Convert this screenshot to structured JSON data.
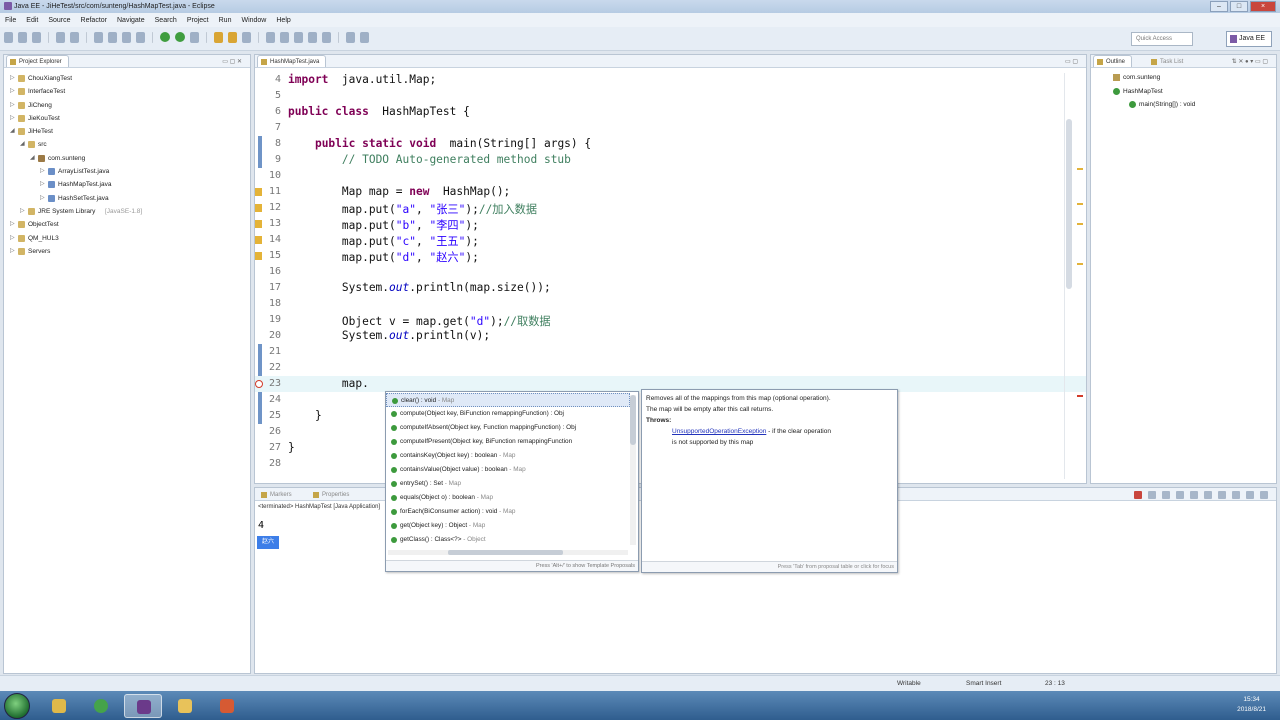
{
  "window": {
    "title": "Java EE - JiHeTest/src/com/sunteng/HashMapTest.java - Eclipse"
  },
  "menu": [
    "File",
    "Edit",
    "Source",
    "Refactor",
    "Navigate",
    "Search",
    "Project",
    "Run",
    "Window",
    "Help"
  ],
  "toolbar": {
    "quick_access": "Quick Access",
    "perspective": "Java EE"
  },
  "explorer": {
    "tab": "Project Explorer",
    "items": [
      {
        "label": "ChouXiangTest",
        "depth": 0,
        "twisty": "▷"
      },
      {
        "label": "InterfaceTest",
        "depth": 0,
        "twisty": "▷"
      },
      {
        "label": "JiCheng",
        "depth": 0,
        "twisty": "▷"
      },
      {
        "label": "JieKouTest",
        "depth": 0,
        "twisty": "▷"
      },
      {
        "label": "JiHeTest",
        "depth": 0,
        "twisty": "◢"
      },
      {
        "label": "src",
        "depth": 1,
        "twisty": "◢"
      },
      {
        "label": "com.sunteng",
        "depth": 2,
        "twisty": "◢"
      },
      {
        "label": "ArrayListTest.java",
        "depth": 3,
        "twisty": "▷"
      },
      {
        "label": "HashMapTest.java",
        "depth": 3,
        "twisty": "▷"
      },
      {
        "label": "HashSetTest.java",
        "depth": 3,
        "twisty": "▷"
      },
      {
        "label": "JRE System Library",
        "extra": "[JavaSE-1.8]",
        "depth": 1,
        "twisty": "▷"
      },
      {
        "label": "ObjectTest",
        "depth": 0,
        "twisty": "▷"
      },
      {
        "label": "QM_HUL3",
        "depth": 0,
        "twisty": "▷"
      },
      {
        "label": "Servers",
        "depth": 0,
        "twisty": "▷"
      }
    ]
  },
  "editor": {
    "tab": "HashMapTest.java",
    "lines": [
      {
        "n": "4",
        "segs": [
          [
            "kw",
            "import"
          ],
          [
            "",
            "  java.util.Map;"
          ]
        ]
      },
      {
        "n": "5",
        "segs": []
      },
      {
        "n": "6",
        "segs": [
          [
            "kw",
            "public class"
          ],
          [
            "",
            "  HashMapTest {"
          ]
        ]
      },
      {
        "n": "7",
        "segs": []
      },
      {
        "n": "8",
        "segs": [
          [
            "",
            "    "
          ],
          [
            "kw",
            "public static void"
          ],
          [
            "",
            "  main(String[] args) {"
          ]
        ],
        "marker": "info"
      },
      {
        "n": "9",
        "segs": [
          [
            "",
            "        "
          ],
          [
            "cm",
            "// TODO Auto-generated method stub"
          ]
        ],
        "marker": "info"
      },
      {
        "n": "10",
        "segs": []
      },
      {
        "n": "11",
        "segs": [
          [
            "",
            "        Map map = "
          ],
          [
            "kw",
            "new"
          ],
          [
            "",
            "  HashMap();"
          ]
        ],
        "marker": "warn"
      },
      {
        "n": "12",
        "segs": [
          [
            "",
            "        map.put("
          ],
          [
            "st",
            "\"a\""
          ],
          [
            "",
            ", "
          ],
          [
            "st",
            "\"张三\""
          ],
          [
            "",
            ");"
          ],
          [
            "cm",
            "//加入数据"
          ]
        ],
        "marker": "warn"
      },
      {
        "n": "13",
        "segs": [
          [
            "",
            "        map.put("
          ],
          [
            "st",
            "\"b\""
          ],
          [
            "",
            ", "
          ],
          [
            "st",
            "\"李四\""
          ],
          [
            "",
            ");"
          ]
        ],
        "marker": "warn"
      },
      {
        "n": "14",
        "segs": [
          [
            "",
            "        map.put("
          ],
          [
            "st",
            "\"c\""
          ],
          [
            "",
            ", "
          ],
          [
            "st",
            "\"王五\""
          ],
          [
            "",
            ");"
          ]
        ],
        "marker": "warn"
      },
      {
        "n": "15",
        "segs": [
          [
            "",
            "        map.put("
          ],
          [
            "st",
            "\"d\""
          ],
          [
            "",
            ", "
          ],
          [
            "st",
            "\"赵六\""
          ],
          [
            "",
            ");"
          ]
        ],
        "marker": "warn"
      },
      {
        "n": "16",
        "segs": []
      },
      {
        "n": "17",
        "segs": [
          [
            "",
            "        System."
          ],
          [
            "fd",
            "out"
          ],
          [
            "",
            ".println(map.size());"
          ]
        ]
      },
      {
        "n": "18",
        "segs": []
      },
      {
        "n": "19",
        "segs": [
          [
            "",
            "        Object v = map.get("
          ],
          [
            "st",
            "\"d\""
          ],
          [
            "",
            ");"
          ],
          [
            "cm",
            "//取数据"
          ]
        ]
      },
      {
        "n": "20",
        "segs": [
          [
            "",
            "        System."
          ],
          [
            "fd",
            "out"
          ],
          [
            "",
            ".println(v);"
          ]
        ]
      },
      {
        "n": "21",
        "segs": [],
        "marker": "info"
      },
      {
        "n": "22",
        "segs": [],
        "marker": "info"
      },
      {
        "n": "23",
        "segs": [
          [
            "",
            "        map."
          ]
        ],
        "marker": "err",
        "current": true
      },
      {
        "n": "24",
        "segs": [],
        "marker": "info"
      },
      {
        "n": "25",
        "segs": [
          [
            "",
            "    }"
          ]
        ],
        "marker": "info"
      },
      {
        "n": "26",
        "segs": []
      },
      {
        "n": "27",
        "segs": [
          [
            "",
            "}"
          ]
        ]
      },
      {
        "n": "28",
        "segs": []
      }
    ]
  },
  "outline": {
    "tabs": [
      "Outline",
      "Task List"
    ],
    "items": [
      {
        "label": "com.sunteng",
        "kind": "pkg",
        "depth": 0
      },
      {
        "label": "HashMapTest",
        "kind": "class",
        "depth": 0
      },
      {
        "label": "main(String[]) : void",
        "kind": "method",
        "depth": 1
      }
    ]
  },
  "console": {
    "tabs": [
      "Markers",
      "Properties",
      "Servers"
    ],
    "title": "<terminated> HashMapTest [Java Application]",
    "output": "4",
    "selected": "赵六"
  },
  "assist": {
    "items": [
      {
        "name": "clear() : void",
        "type": "Map"
      },
      {
        "name": "compute(Object key, BiFunction remappingFunction) : Obj",
        "type": ""
      },
      {
        "name": "computeIfAbsent(Object key, Function mappingFunction) : Obj",
        "type": ""
      },
      {
        "name": "computeIfPresent(Object key, BiFunction remappingFunction",
        "type": ""
      },
      {
        "name": "containsKey(Object key) : boolean",
        "type": "Map"
      },
      {
        "name": "containsValue(Object value) : boolean",
        "type": "Map"
      },
      {
        "name": "entrySet() : Set",
        "type": "Map"
      },
      {
        "name": "equals(Object o) : boolean",
        "type": "Map"
      },
      {
        "name": "forEach(BiConsumer action) : void",
        "type": "Map"
      },
      {
        "name": "get(Object key) : Object",
        "type": "Map"
      },
      {
        "name": "getClass() : Class<?>",
        "type": "Object"
      }
    ],
    "footer": "Press 'Alt+/' to show Template Proposals",
    "doc": {
      "line1": "Removes all of the mappings from this map (optional operation).",
      "line2": "The map will be empty after this call returns.",
      "throws_label": "Throws:",
      "exception": "UnsupportedOperationException",
      "exception_desc": " - if the clear operation",
      "exception_desc2": "is not supported by this map",
      "footer": "Press 'Tab' from proposal table or click for focus"
    }
  },
  "status": {
    "writable": "Writable",
    "insert": "Smart Insert",
    "position": "23 : 13"
  },
  "taskbar": {
    "time": "15:34",
    "date": "2018/8/21"
  }
}
